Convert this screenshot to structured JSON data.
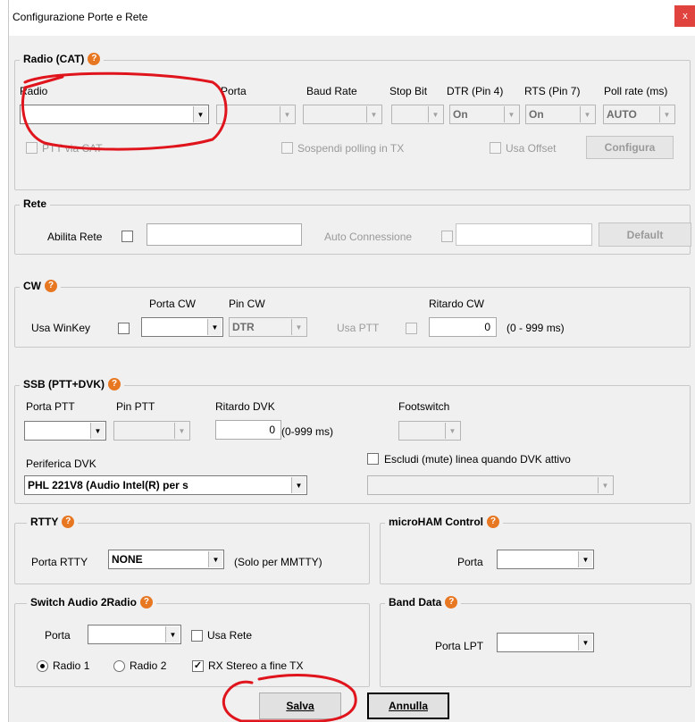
{
  "window": {
    "title": "Configurazione Porte e Rete",
    "close": "x"
  },
  "radio_cat": {
    "title": "Radio (CAT)",
    "col_radio": "Radio",
    "col_porta": "Porta",
    "col_baud": "Baud Rate",
    "col_stop": "Stop Bit",
    "col_dtr": "DTR (Pin 4)",
    "col_rts": "RTS (Pin 7)",
    "col_poll": "Poll rate (ms)",
    "dtr_value": "On",
    "rts_value": "On",
    "poll_value": "AUTO",
    "ptt_via_cat": "PTT via CAT",
    "sospendi": "Sospendi polling in TX",
    "usa_offset": "Usa Offset",
    "configura": "Configura"
  },
  "rete": {
    "title": "Rete",
    "abilita": "Abilita Rete",
    "auto_connessione": "Auto Connessione",
    "default": "Default"
  },
  "cw": {
    "title": "CW",
    "usa_winkey": "Usa WinKey",
    "porta_cw": "Porta CW",
    "pin_cw": "Pin CW",
    "pin_value": "DTR",
    "usa_ptt": "Usa PTT",
    "ritardo": "Ritardo CW",
    "ritardo_value": "0",
    "range": "(0 - 999 ms)"
  },
  "ssb": {
    "title": "SSB (PTT+DVK)",
    "porta_ptt": "Porta PTT",
    "pin_ptt": "Pin PTT",
    "ritardo_dvk": "Ritardo DVK",
    "ritardo_value": "0",
    "range": "(0-999 ms)",
    "footswitch": "Footswitch",
    "periferica": "Periferica DVK",
    "periferica_value": "PHL 221V8 (Audio Intel(R) per s",
    "escludi": "Escludi (mute) linea quando DVK attivo"
  },
  "rtty": {
    "title": "RTTY",
    "porta": "Porta RTTY",
    "porta_value": "NONE",
    "note": "(Solo per MMTTY)"
  },
  "microham": {
    "title": "microHAM Control",
    "porta": "Porta"
  },
  "switch_audio": {
    "title": "Switch Audio 2Radio",
    "porta": "Porta",
    "usa_rete": "Usa Rete",
    "radio1": "Radio 1",
    "radio2": "Radio 2",
    "rx_stereo": "RX Stereo a fine TX"
  },
  "band_data": {
    "title": "Band Data",
    "porta_lpt": "Porta LPT"
  },
  "footer": {
    "salva": "Salva",
    "annulla": "Annulla"
  },
  "icons": {
    "help": "?",
    "check": "✓",
    "arrow": "▼"
  },
  "colors": {
    "help_icon": "#e87722",
    "close_button": "#e0433d",
    "annotation": "#e0141c"
  }
}
